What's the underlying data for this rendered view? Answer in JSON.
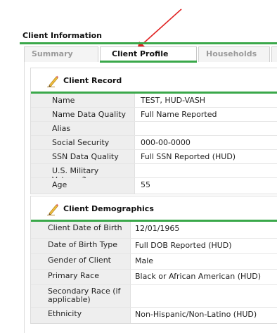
{
  "section": {
    "title": "Client Information"
  },
  "tabs": [
    {
      "label": "Summary"
    },
    {
      "label": "Client Profile"
    },
    {
      "label": "Households"
    },
    {
      "label": "P"
    }
  ],
  "client_record": {
    "title": "Client Record",
    "rows": [
      {
        "label": "Name",
        "value": "TEST, HUD-VASH"
      },
      {
        "label": "Name Data Quality",
        "value": "Full Name Reported"
      },
      {
        "label": "Alias",
        "value": ""
      },
      {
        "label": "Social Security",
        "value": "000-00-0000"
      },
      {
        "label": "SSN Data Quality",
        "value": "Full SSN Reported (HUD)"
      },
      {
        "label": "U.S. Military Veteran?",
        "value": ""
      },
      {
        "label": "Age",
        "value": "55"
      }
    ]
  },
  "client_demographics": {
    "title": "Client Demographics",
    "rows": [
      {
        "label": "Client Date of Birth",
        "value": "12/01/1965"
      },
      {
        "label": "Date of Birth Type",
        "value": "Full DOB Reported (HUD)"
      },
      {
        "label": "Gender of Client",
        "value": "Male"
      },
      {
        "label": "Primary Race",
        "value": "Black or African American (HUD)"
      },
      {
        "label": "Secondary Race (if applicable)",
        "value": ""
      },
      {
        "label": "Ethnicity",
        "value": "Non-Hispanic/Non-Latino (HUD)"
      }
    ]
  },
  "colors": {
    "accent": "#3aa84a",
    "annotation_arrow": "#e02020",
    "label_bg": "#eeeeee"
  },
  "icons": {
    "panel_header": "pencil-icon"
  }
}
